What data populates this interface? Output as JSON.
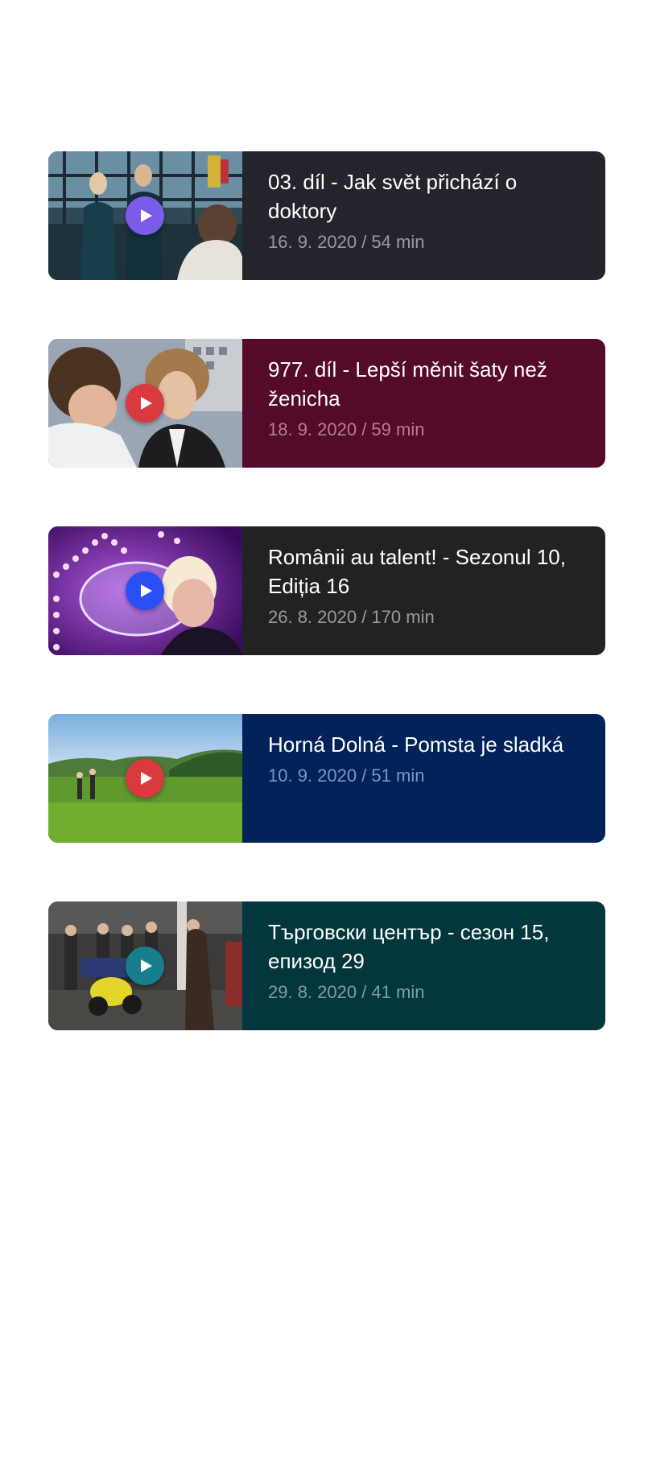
{
  "episodes": [
    {
      "title": "03. díl - Jak svět přichází o doktory",
      "meta": "16. 9. 2020 / 54 min",
      "bg_color": "#24252c",
      "meta_color": "#9a9ba2",
      "play_color": "#7b5ce6",
      "play_icon": "play-icon",
      "thumbnail": "office scene with two people"
    },
    {
      "title": "977. díl - Lepší měnit šaty než ženicha",
      "meta": "18. 9. 2020 / 59 min",
      "bg_color": "#540a29",
      "meta_color": "#b27f94",
      "play_color": "#d83a3f",
      "play_icon": "play-icon",
      "thumbnail": "two people in close conversation"
    },
    {
      "title": "Românii au talent! - Sezonul 10, Ediția 16",
      "meta": "26. 8. 2020 / 170 min",
      "bg_color": "#222222",
      "meta_color": "#9a9a9a",
      "play_color": "#2a4ff5",
      "play_icon": "play-icon",
      "thumbnail": "stage performer with bubbles and lights"
    },
    {
      "title": "Horná Dolná - Pomsta je sladká",
      "meta": "10. 9. 2020 / 51 min",
      "bg_color": "#02235a",
      "meta_color": "#7e95c1",
      "play_color": "#d83a3f",
      "play_icon": "play-icon",
      "thumbnail": "people in a green meadow"
    },
    {
      "title": "Търговски център - сезон 15, епизод 29",
      "meta": "29. 8. 2020 / 41 min",
      "bg_color": "#03373d",
      "meta_color": "#7f9ea2",
      "play_color": "#167e8c",
      "play_icon": "play-icon",
      "thumbnail": "crowd around a yellow motorbike in a garage"
    }
  ]
}
